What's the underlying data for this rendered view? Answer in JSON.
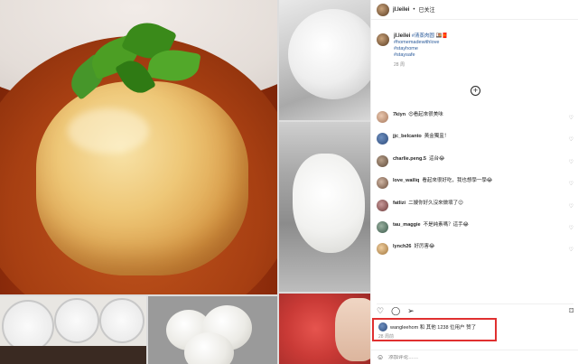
{
  "header": {
    "username": "jl.leilei",
    "separator": "•",
    "follow_label": "已关注"
  },
  "caption": {
    "username": "jl.leilei",
    "text": "#清蒸肉圆 🍱🧧",
    "tags": [
      "#homemadewithlove",
      "#stayhome",
      "#staysafe"
    ],
    "time": "28 周"
  },
  "comments": [
    {
      "user": "7kiyn",
      "text": "😍看起來很美味"
    },
    {
      "user": "jjc_belcanto",
      "text": "黃金獨盅！"
    },
    {
      "user": "charlie.peng.5",
      "text": "這台😂"
    },
    {
      "user": "love_wailiq",
      "text": "看起來很好吃，我也想學一學😂"
    },
    {
      "user": "fatlizi",
      "text": "二嫂你好久沒來做壞了😉"
    },
    {
      "user": "tau_maggie",
      "text": "不是純素嗎？這手😂"
    },
    {
      "user": "lynch26",
      "text": "好厉害😂"
    }
  ],
  "likes": {
    "text": "wangleehom 和 其他 1238 位用户 赞了",
    "date": "28 周前"
  },
  "comment_input": {
    "placeholder": "添加评论……"
  },
  "icons": {
    "load_more": "plus-circle-icon",
    "like": "heart-icon",
    "comment": "comment-bubble-icon",
    "share": "paper-plane-icon",
    "save": "bookmark-icon",
    "emoji": "smiley-icon"
  },
  "colors": {
    "highlight_border": "#e03030",
    "hashtag": "#2a5a9a",
    "muted": "#8e8e8e"
  }
}
